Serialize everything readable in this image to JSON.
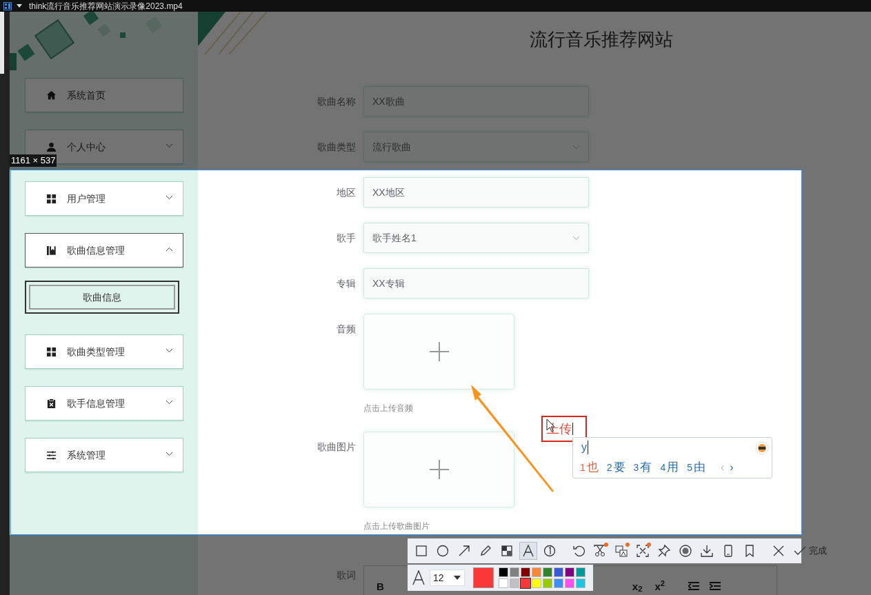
{
  "player": {
    "title": "think流行音乐推荐网站演示录像2023.mp4"
  },
  "site": {
    "title": "流行音乐推荐网站"
  },
  "sidebar": {
    "items": [
      {
        "label": "系统首页",
        "kind": "link"
      },
      {
        "label": "个人中心",
        "kind": "menu",
        "expanded": false
      },
      {
        "label": "用户管理",
        "kind": "menu",
        "expanded": false
      },
      {
        "label": "歌曲信息管理",
        "kind": "menu",
        "expanded": true,
        "children": [
          {
            "label": "歌曲信息",
            "selected": true
          }
        ]
      },
      {
        "label": "歌曲类型管理",
        "kind": "menu",
        "expanded": false
      },
      {
        "label": "歌手信息管理",
        "kind": "menu",
        "expanded": false
      },
      {
        "label": "系统管理",
        "kind": "menu",
        "expanded": false
      }
    ]
  },
  "form": {
    "fields": [
      {
        "label": "歌曲名称",
        "kind": "text",
        "value": "XX歌曲"
      },
      {
        "label": "歌曲类型",
        "kind": "select",
        "value": "流行歌曲"
      },
      {
        "label": "地区",
        "kind": "text",
        "value": "XX地区"
      },
      {
        "label": "歌手",
        "kind": "select",
        "value": "歌手姓名1"
      },
      {
        "label": "专辑",
        "kind": "text",
        "value": "XX专辑"
      },
      {
        "label": "音频",
        "kind": "upload",
        "hint": "点击上传音频"
      },
      {
        "label": "歌曲图片",
        "kind": "upload",
        "hint": "点击上传歌曲图片"
      },
      {
        "label": "歌词",
        "kind": "editor",
        "tools": [
          "B",
          "x$_{2}$",
          "x$^{2}$"
        ]
      }
    ]
  },
  "screenshot_tool": {
    "size_label": "1161 × 537",
    "text_box": "上传",
    "ime": {
      "input": "y",
      "candidates": [
        {
          "index": "1",
          "text": "也",
          "selected": true
        },
        {
          "index": "2",
          "text": "要",
          "selected": false
        },
        {
          "index": "3",
          "text": "有",
          "selected": false
        },
        {
          "index": "4",
          "text": "用",
          "selected": false
        },
        {
          "index": "5",
          "text": "由",
          "selected": false
        }
      ],
      "prev": "‹",
      "next": "›"
    },
    "tools": [
      {
        "kind": "rect",
        "selected": false
      },
      {
        "kind": "ellipse",
        "selected": false
      },
      {
        "kind": "arrow",
        "selected": false
      },
      {
        "kind": "pen",
        "selected": false
      },
      {
        "kind": "mosaic",
        "selected": false
      },
      {
        "kind": "text",
        "selected": true
      },
      {
        "kind": "number",
        "selected": false
      },
      {
        "kind": "undo",
        "selected": false
      },
      {
        "kind": "scissors",
        "selected": false,
        "badge": true
      },
      {
        "kind": "translate",
        "selected": false,
        "badge": true
      },
      {
        "kind": "scan",
        "selected": false,
        "badge": true
      },
      {
        "kind": "pin",
        "selected": false
      },
      {
        "kind": "record",
        "selected": false
      },
      {
        "kind": "download",
        "selected": false
      },
      {
        "kind": "phone",
        "selected": false
      },
      {
        "kind": "bookmark",
        "selected": false
      },
      {
        "kind": "cancel",
        "selected": false
      },
      {
        "kind": "done",
        "selected": false,
        "label": "完成"
      }
    ],
    "font_size": "12",
    "palette": [
      {
        "color": "#000000",
        "selected": false
      },
      {
        "color": "#808080",
        "selected": false
      },
      {
        "color": "#800000",
        "selected": false
      },
      {
        "color": "#f7883a",
        "selected": false
      },
      {
        "color": "#308430",
        "selected": false
      },
      {
        "color": "#385ad3",
        "selected": false
      },
      {
        "color": "#800080",
        "selected": false
      },
      {
        "color": "#009999",
        "selected": false
      },
      {
        "color": "#ffffff",
        "selected": false
      },
      {
        "color": "#c0c0c0",
        "selected": false
      },
      {
        "color": "#fb3838",
        "selected": true
      },
      {
        "color": "#ffff00",
        "selected": false
      },
      {
        "color": "#99cc00",
        "selected": false
      },
      {
        "color": "#3d8ef7",
        "selected": false
      },
      {
        "color": "#ff4df0",
        "selected": false
      },
      {
        "color": "#1bc7e0",
        "selected": false
      }
    ]
  }
}
